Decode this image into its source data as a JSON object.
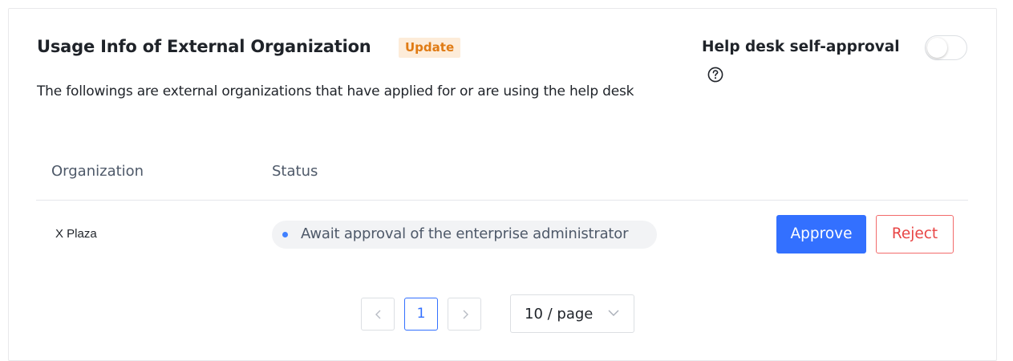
{
  "header": {
    "title": "Usage Info of External Organization",
    "update_badge": "Update",
    "description": "The followings are external organizations that have applied for or are using the help desk",
    "help_desk_label": "Help desk self-approval",
    "help_desk_enabled": false
  },
  "table": {
    "columns": [
      "Organization",
      "Status"
    ],
    "rows": [
      {
        "organization": "X Plaza",
        "status": "Await approval of the enterprise administrator",
        "approve_label": "Approve",
        "reject_label": "Reject"
      }
    ]
  },
  "pagination": {
    "current_page": "1",
    "page_size": "10 / page"
  },
  "colors": {
    "accent": "#3370ff",
    "badge_text": "#e07b14",
    "reject": "#e84545"
  },
  "icons": {
    "help": "question-circle-icon",
    "prev": "chevron-left-icon",
    "next": "chevron-right-icon",
    "dropdown": "chevron-down-icon"
  }
}
